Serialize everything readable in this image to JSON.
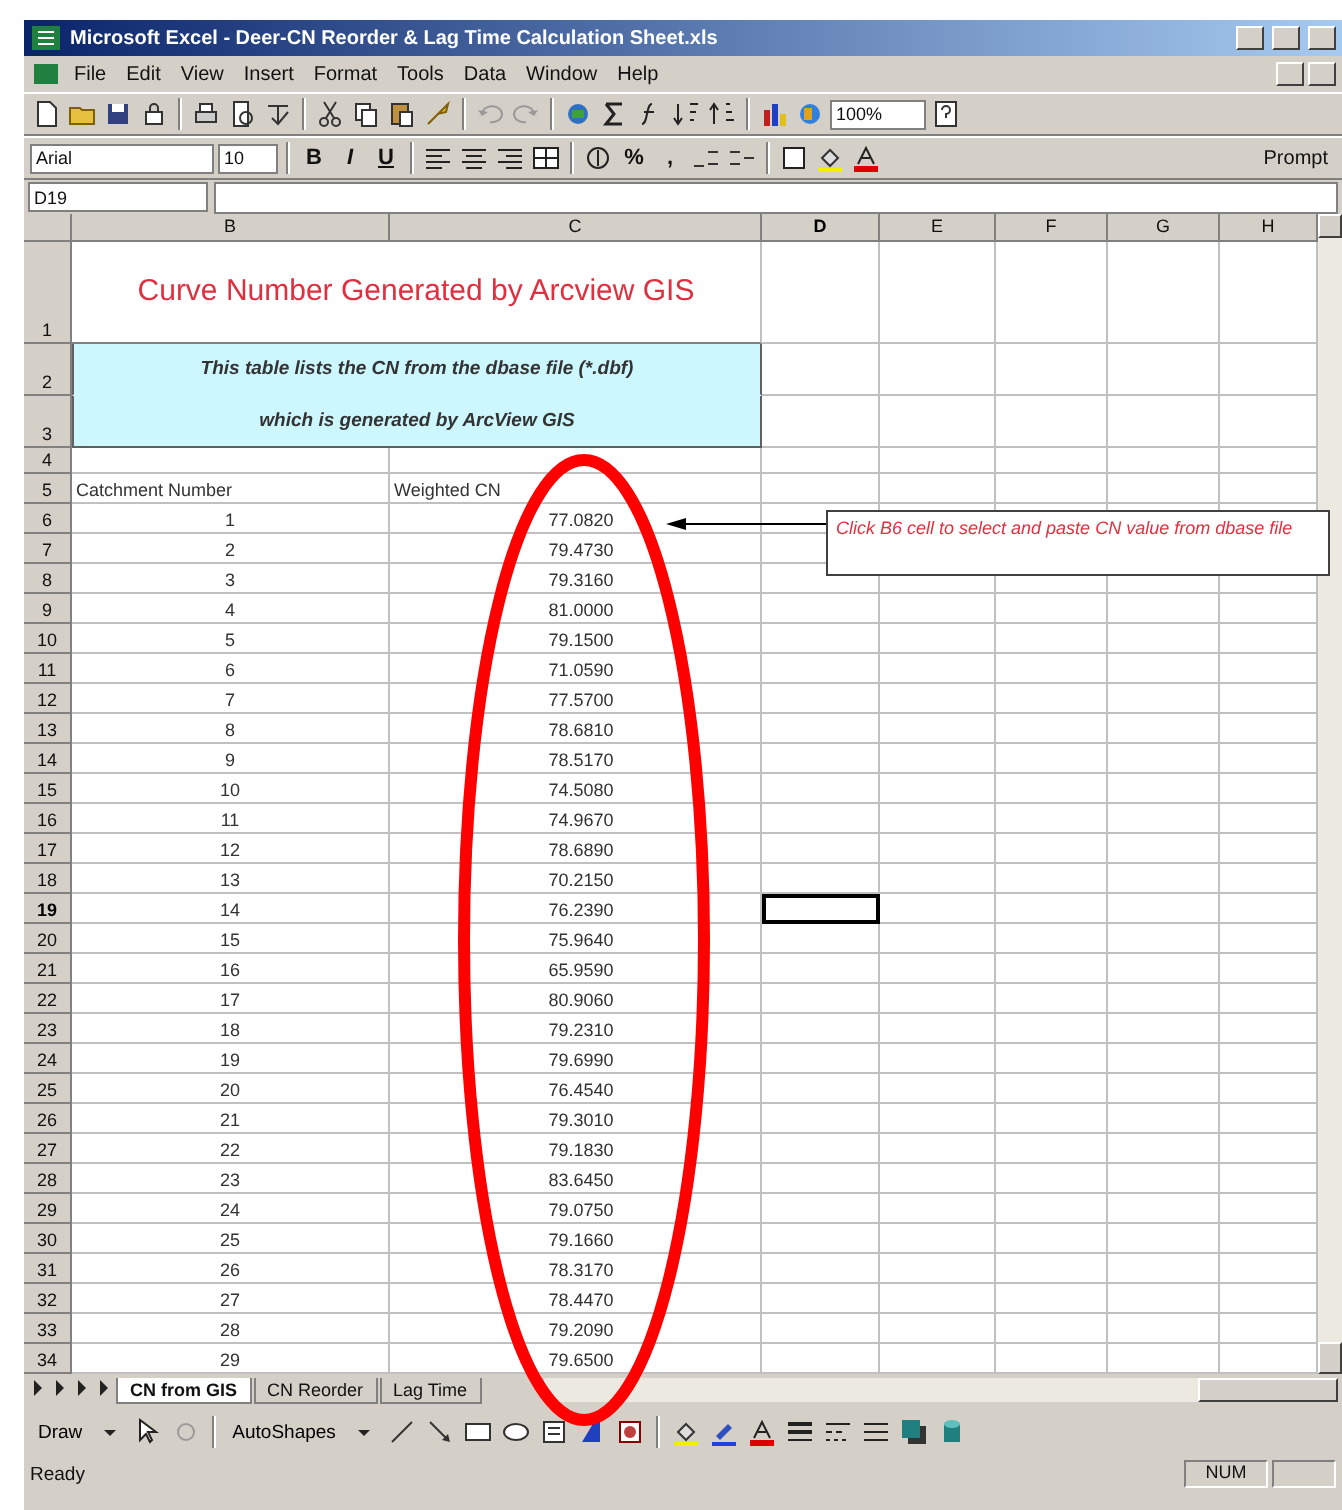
{
  "window": {
    "title": "Microsoft Excel - Deer-CN Reorder & Lag Time Calculation Sheet.xls"
  },
  "menu": [
    "File",
    "Edit",
    "View",
    "Insert",
    "Format",
    "Tools",
    "Data",
    "Window",
    "Help"
  ],
  "standard_toolbar": {
    "zoom": "100%"
  },
  "formatting_toolbar": {
    "font": "Arial",
    "size": "10",
    "style_buttons": [
      "B",
      "I",
      "U"
    ],
    "percent": "%",
    "comma": ",",
    "prompt": "Prompt"
  },
  "name_box": "D19",
  "columns": [
    {
      "label": "B",
      "selected": false
    },
    {
      "label": "C",
      "selected": false
    },
    {
      "label": "D",
      "selected": true
    },
    {
      "label": "E",
      "selected": false
    },
    {
      "label": "F",
      "selected": false
    },
    {
      "label": "G",
      "selected": false
    },
    {
      "label": "H",
      "selected": false
    }
  ],
  "rows": [
    {
      "number": "1",
      "kind": "title",
      "text": "Curve Number Generated by Arcview GIS",
      "selected": false
    },
    {
      "number": "2",
      "kind": "note",
      "text": "This table lists the CN from the dbase file (*.dbf)",
      "selected": false
    },
    {
      "number": "3",
      "kind": "note",
      "text": "which is generated by ArcView GIS",
      "selected": false
    },
    {
      "number": "4",
      "kind": "blank",
      "selected": false
    },
    {
      "number": "5",
      "kind": "header",
      "cells": [
        "Catchment Number",
        "Weighted CN"
      ],
      "selected": false
    },
    {
      "number": "6",
      "kind": "data",
      "cells": [
        "1",
        "77.0820"
      ],
      "selected": false
    },
    {
      "number": "7",
      "kind": "data",
      "cells": [
        "2",
        "79.4730"
      ],
      "selected": false
    },
    {
      "number": "8",
      "kind": "data",
      "cells": [
        "3",
        "79.3160"
      ],
      "selected": false
    },
    {
      "number": "9",
      "kind": "data",
      "cells": [
        "4",
        "81.0000"
      ],
      "selected": false
    },
    {
      "number": "10",
      "kind": "data",
      "cells": [
        "5",
        "79.1500"
      ],
      "selected": false
    },
    {
      "number": "11",
      "kind": "data",
      "cells": [
        "6",
        "71.0590"
      ],
      "selected": false
    },
    {
      "number": "12",
      "kind": "data",
      "cells": [
        "7",
        "77.5700"
      ],
      "selected": false
    },
    {
      "number": "13",
      "kind": "data",
      "cells": [
        "8",
        "78.6810"
      ],
      "selected": false
    },
    {
      "number": "14",
      "kind": "data",
      "cells": [
        "9",
        "78.5170"
      ],
      "selected": false
    },
    {
      "number": "15",
      "kind": "data",
      "cells": [
        "10",
        "74.5080"
      ],
      "selected": false
    },
    {
      "number": "16",
      "kind": "data",
      "cells": [
        "11",
        "74.9670"
      ],
      "selected": false
    },
    {
      "number": "17",
      "kind": "data",
      "cells": [
        "12",
        "78.6890"
      ],
      "selected": false
    },
    {
      "number": "18",
      "kind": "data",
      "cells": [
        "13",
        "70.2150"
      ],
      "selected": false
    },
    {
      "number": "19",
      "kind": "data",
      "cells": [
        "14",
        "76.2390"
      ],
      "selected": true
    },
    {
      "number": "20",
      "kind": "data",
      "cells": [
        "15",
        "75.9640"
      ],
      "selected": false
    },
    {
      "number": "21",
      "kind": "data",
      "cells": [
        "16",
        "65.9590"
      ],
      "selected": false
    },
    {
      "number": "22",
      "kind": "data",
      "cells": [
        "17",
        "80.9060"
      ],
      "selected": false
    },
    {
      "number": "23",
      "kind": "data",
      "cells": [
        "18",
        "79.2310"
      ],
      "selected": false
    },
    {
      "number": "24",
      "kind": "data",
      "cells": [
        "19",
        "79.6990"
      ],
      "selected": false
    },
    {
      "number": "25",
      "kind": "data",
      "cells": [
        "20",
        "76.4540"
      ],
      "selected": false
    },
    {
      "number": "26",
      "kind": "data",
      "cells": [
        "21",
        "79.3010"
      ],
      "selected": false
    },
    {
      "number": "27",
      "kind": "data",
      "cells": [
        "22",
        "79.1830"
      ],
      "selected": false
    },
    {
      "number": "28",
      "kind": "data",
      "cells": [
        "23",
        "83.6450"
      ],
      "selected": false
    },
    {
      "number": "29",
      "kind": "data",
      "cells": [
        "24",
        "79.0750"
      ],
      "selected": false
    },
    {
      "number": "30",
      "kind": "data",
      "cells": [
        "25",
        "79.1660"
      ],
      "selected": false
    },
    {
      "number": "31",
      "kind": "data",
      "cells": [
        "26",
        "78.3170"
      ],
      "selected": false
    },
    {
      "number": "32",
      "kind": "data",
      "cells": [
        "27",
        "78.4470"
      ],
      "selected": false
    },
    {
      "number": "33",
      "kind": "data",
      "cells": [
        "28",
        "79.2090"
      ],
      "selected": false
    },
    {
      "number": "34",
      "kind": "data",
      "cells": [
        "29",
        "79.6500"
      ],
      "selected": false
    }
  ],
  "comment": {
    "text": "Click B6 cell to select and paste CN value from dbase file"
  },
  "sheet_tabs": [
    {
      "label": "CN from GIS",
      "selected": true
    },
    {
      "label": "CN Reorder",
      "selected": false
    },
    {
      "label": "Lag Time",
      "selected": false
    }
  ],
  "drawing_toolbar": {
    "draw": "Draw",
    "autoshapes": "AutoShapes"
  },
  "status_bar": {
    "status": "Ready",
    "num": "NUM"
  }
}
